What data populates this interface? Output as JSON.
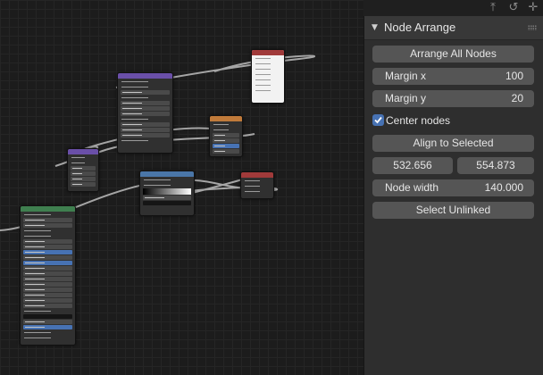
{
  "toolbar": {
    "icons": [
      "arrow-up-icon",
      "link-icon",
      "grid-snap-icon"
    ]
  },
  "nodes": [
    {
      "name": "node-principled-bsdf",
      "header_color": "#3f7f4f"
    },
    {
      "name": "node-mapping",
      "header_color": "#6a4fa8"
    },
    {
      "name": "node-texture-coordinate",
      "header_color": "#6a4fa8"
    },
    {
      "name": "node-color-ramp",
      "header_color": "#4a76a8"
    },
    {
      "name": "node-image-texture",
      "header_color": "#c07a3a"
    },
    {
      "name": "node-material-output",
      "header_color": "#a03a3a"
    },
    {
      "name": "node-frame-top",
      "header_color": "#a03a3a"
    }
  ],
  "panel": {
    "title": "Node Arrange",
    "arrange_all": "Arrange All Nodes",
    "margin_x_label": "Margin x",
    "margin_x_value": "100",
    "margin_y_label": "Margin y",
    "margin_y_value": "20",
    "center_nodes_label": "Center nodes",
    "center_nodes_checked": true,
    "align_selected": "Align to Selected",
    "coord_x": "532.656",
    "coord_y": "554.873",
    "node_width_label": "Node width",
    "node_width_value": "140.000",
    "select_unlinked": "Select Unlinked"
  },
  "colors": {
    "accent": "#4772b3",
    "button": "#555555",
    "panel_bg": "#2e2e2e"
  }
}
